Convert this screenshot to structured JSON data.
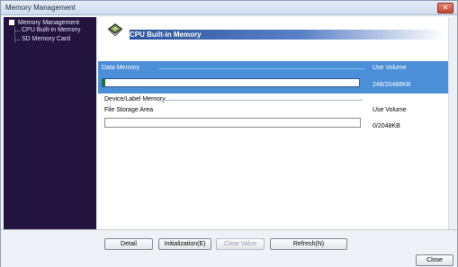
{
  "window": {
    "title": "Memory Management",
    "close_glyph": "✕"
  },
  "sidebar": {
    "root_label": "Memory Management",
    "items": [
      {
        "label": "CPU Built-in Memory"
      },
      {
        "label": "SD Memory Card"
      }
    ]
  },
  "main": {
    "header_title": "CPU Built-in Memory",
    "cpu_icon": "cpu-chip-icon",
    "data_memory": {
      "label": "Data Memory",
      "use_volume_label": "Use Volume",
      "used_kb": 248,
      "total_kb": 20488,
      "usage_text": "248/20488KB"
    },
    "device_label_memory": {
      "label": "Device/Label Memory"
    },
    "file_storage": {
      "label": "File Storage Area",
      "use_volume_label": "Use Volume",
      "usage_text": "0/2048KB"
    }
  },
  "footer": {
    "detail": "Detail",
    "initialization": "Initialization(E)",
    "clear_value": "Clear Value",
    "refresh": "Refresh(N)",
    "close": "Close"
  },
  "colors": {
    "sidebar_bg": "#22143e",
    "panel_blue": "#4a8fd7",
    "header_gradient_start": "#2a5499",
    "usage_fill": "#1e7a26"
  }
}
